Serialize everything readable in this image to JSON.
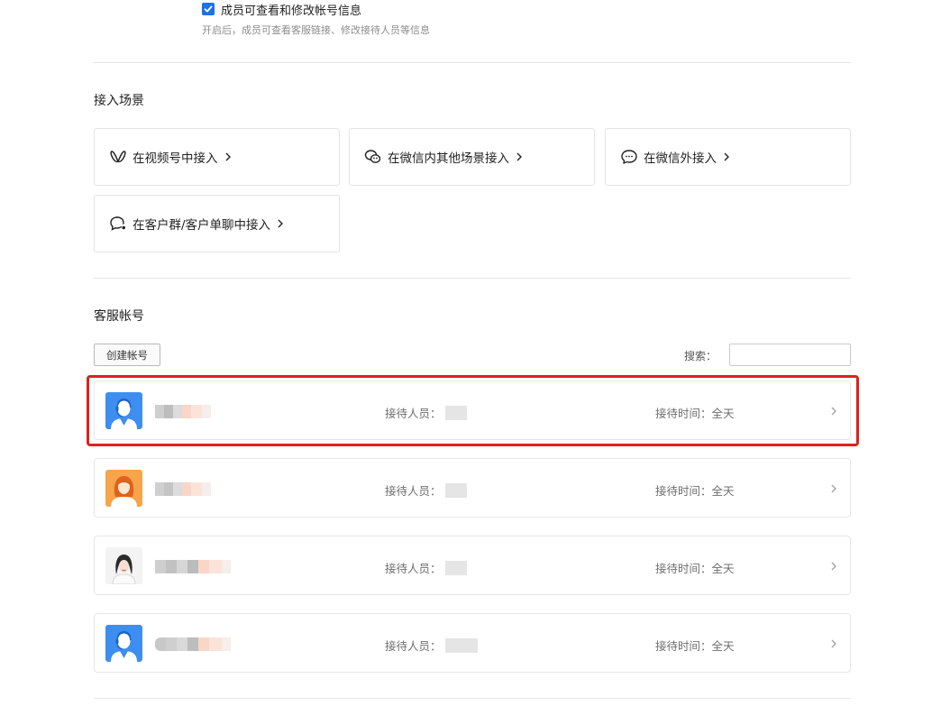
{
  "permission": {
    "checked": true,
    "label": "成员可查看和修改帐号信息",
    "description": "开启后，成员可查看客服链接、修改接待人员等信息"
  },
  "scenes": {
    "title": "接入场景",
    "items": [
      {
        "label": "在视频号中接入",
        "icon": "channels-icon"
      },
      {
        "label": "在微信内其他场景接入",
        "icon": "wechat-icon"
      },
      {
        "label": "在微信外接入",
        "icon": "chat-bubble-icon"
      },
      {
        "label": "在客户群/客户单聊中接入",
        "icon": "customer-chat-icon"
      }
    ]
  },
  "accounts": {
    "title": "客服帐号",
    "create_label": "创建帐号",
    "search_label": "搜索：",
    "search_value": "",
    "rows": [
      {
        "avatar": "male-service-avatar",
        "staff_label": "接待人员：",
        "time_label": "接待时间：全天"
      },
      {
        "avatar": "female-service-avatar",
        "staff_label": "接待人员：",
        "time_label": "接待时间：全天"
      },
      {
        "avatar": "photo-avatar",
        "staff_label": "接待人员：",
        "time_label": "接待时间：全天"
      },
      {
        "avatar": "male-service-avatar",
        "staff_label": "接待人员：",
        "time_label": "接待时间：全天"
      }
    ]
  },
  "colors": {
    "accent": "#1a73e8",
    "highlight": "#e0201e",
    "avatar_blue": "#3d8ef0",
    "avatar_orange": "#f7a44a"
  }
}
